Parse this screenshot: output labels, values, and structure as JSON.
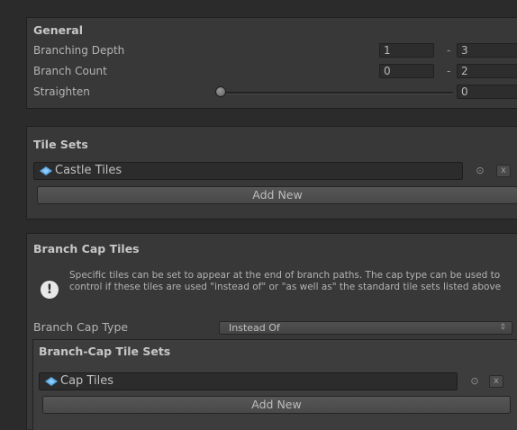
{
  "general": {
    "title": "General",
    "branching_depth": {
      "label": "Branching Depth",
      "min": "1",
      "max": "3"
    },
    "branch_count": {
      "label": "Branch Count",
      "min": "0",
      "max": "2"
    },
    "straighten": {
      "label": "Straighten",
      "value": "0",
      "slider_fraction": 0.0
    },
    "separator": "-"
  },
  "tile_sets": {
    "title": "Tile Sets",
    "items": [
      {
        "label": "Castle Tiles",
        "icon": "tileset-asset-icon"
      }
    ],
    "add_label": "Add New"
  },
  "branch_caps": {
    "title": "Branch Cap Tiles",
    "info_icon": "exclamation-icon",
    "info_text": "Specific tiles can be set to appear at the end of branch paths. The cap type can be used to control if these tiles are used \"instead of\" or \"as well as\" the standard tile sets listed above",
    "cap_type_label": "Branch Cap Type",
    "cap_type_value": "Instead Of",
    "sub_title": "Branch-Cap Tile Sets",
    "items": [
      {
        "label": "Cap Tiles",
        "icon": "tileset-asset-icon"
      }
    ],
    "add_label": "Add New"
  },
  "glyphs": {
    "picker": "⊙",
    "remove": "x",
    "dropdown_arrow": "⇕"
  },
  "colors": {
    "panel": "#383838",
    "background": "#2b2b2b",
    "asset_icon": "#5aa9e6"
  }
}
